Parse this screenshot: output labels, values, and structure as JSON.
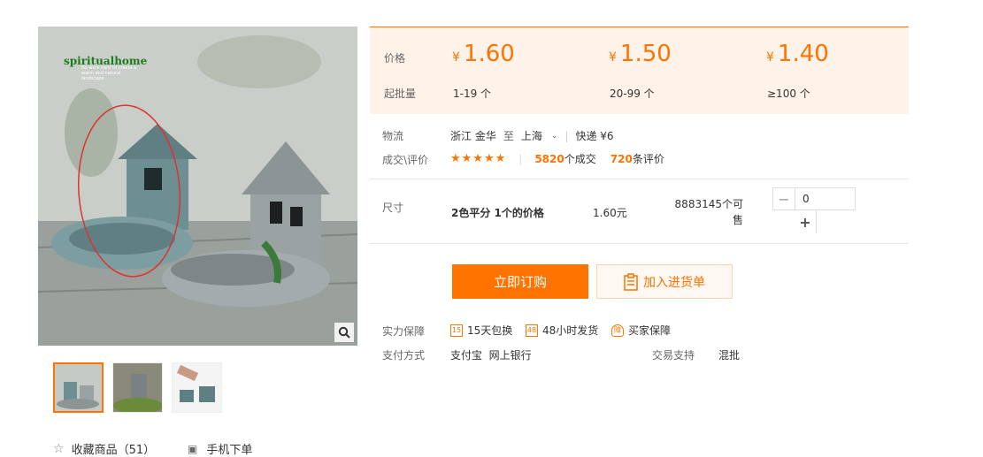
{
  "image": {
    "logo_text": "spiritualhome",
    "logo_sub": "No work hard to create a warm and natural landscape"
  },
  "favorites": {
    "label": "收藏商品（51）"
  },
  "mobile_order": {
    "label": "手机下单"
  },
  "price_panel": {
    "price_label": "价格",
    "min_qty_label": "起批量",
    "currency": "¥",
    "tiers": [
      {
        "price": "1.60",
        "qty": "1-19 个"
      },
      {
        "price": "1.50",
        "qty": "20-99 个"
      },
      {
        "price": "1.40",
        "qty": "≥100 个"
      }
    ]
  },
  "logistics": {
    "label": "物流",
    "from": "浙江 金华",
    "to_word": "至",
    "to": "上海",
    "shipping": "快递 ¥6"
  },
  "reviews": {
    "label": "成交\\评价",
    "stars": "★★★★★",
    "deals_count": "5820",
    "deals_text": "个成交",
    "review_count": "720",
    "review_text": "条评价"
  },
  "size": {
    "label": "尺寸",
    "option": "2色平分 1个的价格",
    "price": "1.60元",
    "stock_line1": "8883145个可",
    "stock_line2": "售",
    "quantity": "0",
    "minus": "−",
    "plus": "+"
  },
  "actions": {
    "buy_label": "立即订购",
    "cart_label": "加入进货单"
  },
  "guarantees": {
    "label": "实力保障",
    "items": [
      {
        "icon": "15",
        "text": "15天包换"
      },
      {
        "icon": "48",
        "text": "48小时发货"
      },
      {
        "icon": "障",
        "text": "买家保障"
      }
    ]
  },
  "payment": {
    "label": "支付方式",
    "methods": "支付宝  网上银行",
    "trade_label": "交易支持",
    "trade_value": "混批"
  },
  "colors": {
    "accent": "#ff7300",
    "panel_bg": "#fff2e8"
  }
}
